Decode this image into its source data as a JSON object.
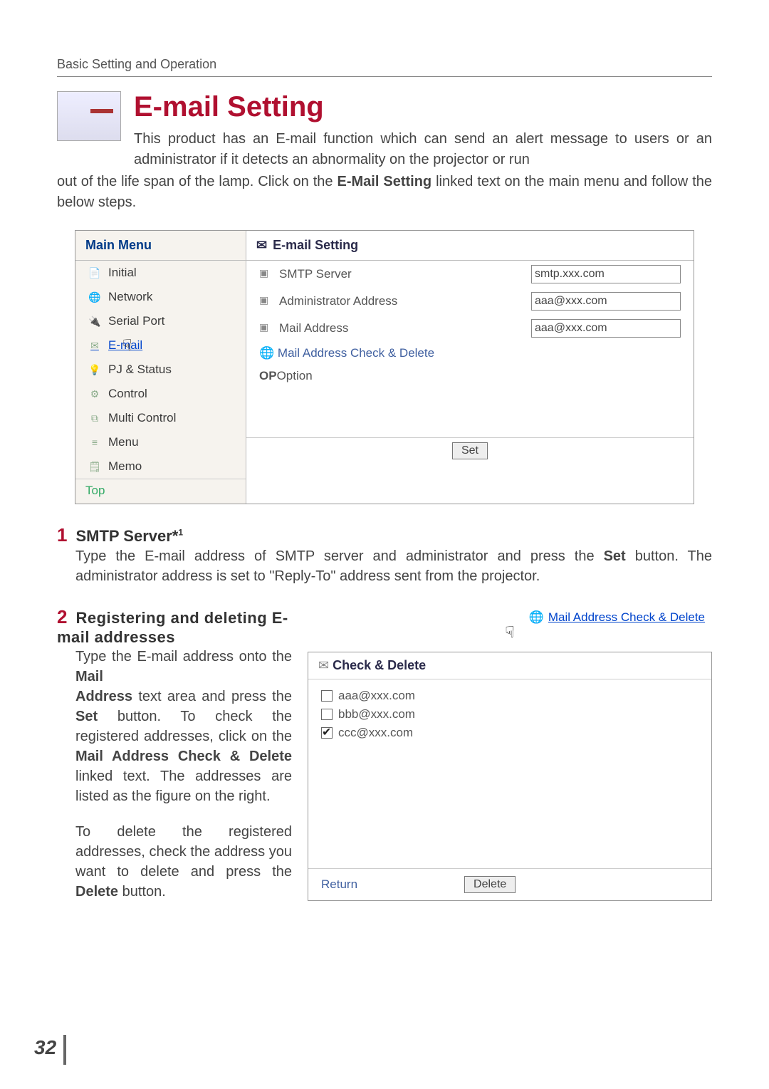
{
  "header": "Basic Setting and Operation",
  "title": "E-mail Setting",
  "intro_top": "This product has an E-mail function which can send an alert message to users or an administrator if it detects an abnormality on the projector or run",
  "intro_bottom_pre": "out of the life span of the lamp. Click on the ",
  "intro_bottom_bold": "E-Mail Setting",
  "intro_bottom_post": " linked text on the main menu and follow the below steps.",
  "app": {
    "menu_header": "Main Menu",
    "items": [
      {
        "label": "Initial",
        "icon": "📄"
      },
      {
        "label": "Network",
        "icon": "🌐"
      },
      {
        "label": "Serial Port",
        "icon": "🔌"
      },
      {
        "label": "E-mail",
        "icon": "✉",
        "active": true
      },
      {
        "label": "PJ     & Status",
        "icon": "💡"
      },
      {
        "label": "Control",
        "icon": "⚙"
      },
      {
        "label": "Multi Control",
        "icon": "⧉"
      },
      {
        "label": "Menu",
        "icon": "≡"
      },
      {
        "label": "Memo",
        "icon": "🗒"
      }
    ],
    "top_link": "Top",
    "panel_header": "E-mail Setting",
    "rows": [
      {
        "label": "SMTP Server",
        "value": "smtp.xxx.com"
      },
      {
        "label": "Administrator Address",
        "value": "aaa@xxx.com"
      },
      {
        "label": "Mail Address",
        "value": "aaa@xxx.com"
      }
    ],
    "link_row": "Mail Address Check & Delete",
    "op_pref": "OP",
    "option_row": "Option",
    "set_btn": "Set"
  },
  "step1": {
    "num": "1",
    "title_pre": "SMTP Server*",
    "title_sup": "1",
    "body_pre": "Type the E-mail address of SMTP server and administrator and press the ",
    "body_bold": "Set",
    "body_post": " button. The administrator address is set to \"Reply-To\" address sent from the projector."
  },
  "step2": {
    "num": "2",
    "title": "Registering and deleting E-mail addresses",
    "left_top_pre": "Type the E-mail address onto the ",
    "left_top_bold": "Mail",
    "left_body": "<b>Address</b> text area and press the <b>Set</b> button. To check the registered addresses, click on the <b>Mail Address Check & Delete</b> linked text. The addresses are listed as the figure on the right.",
    "left_para2": "To delete the registered addresses, check the address you want to delete and press the <b>Delete</b> button.",
    "mail_link": "Mail Address Check & Delete",
    "check_title": "Check & Delete",
    "addresses": [
      {
        "email": "aaa@xxx.com",
        "checked": false
      },
      {
        "email": "bbb@xxx.com",
        "checked": false
      },
      {
        "email": "ccc@xxx.com",
        "checked": true
      }
    ],
    "return": "Return",
    "delete_btn": "Delete"
  },
  "page_num": "32"
}
